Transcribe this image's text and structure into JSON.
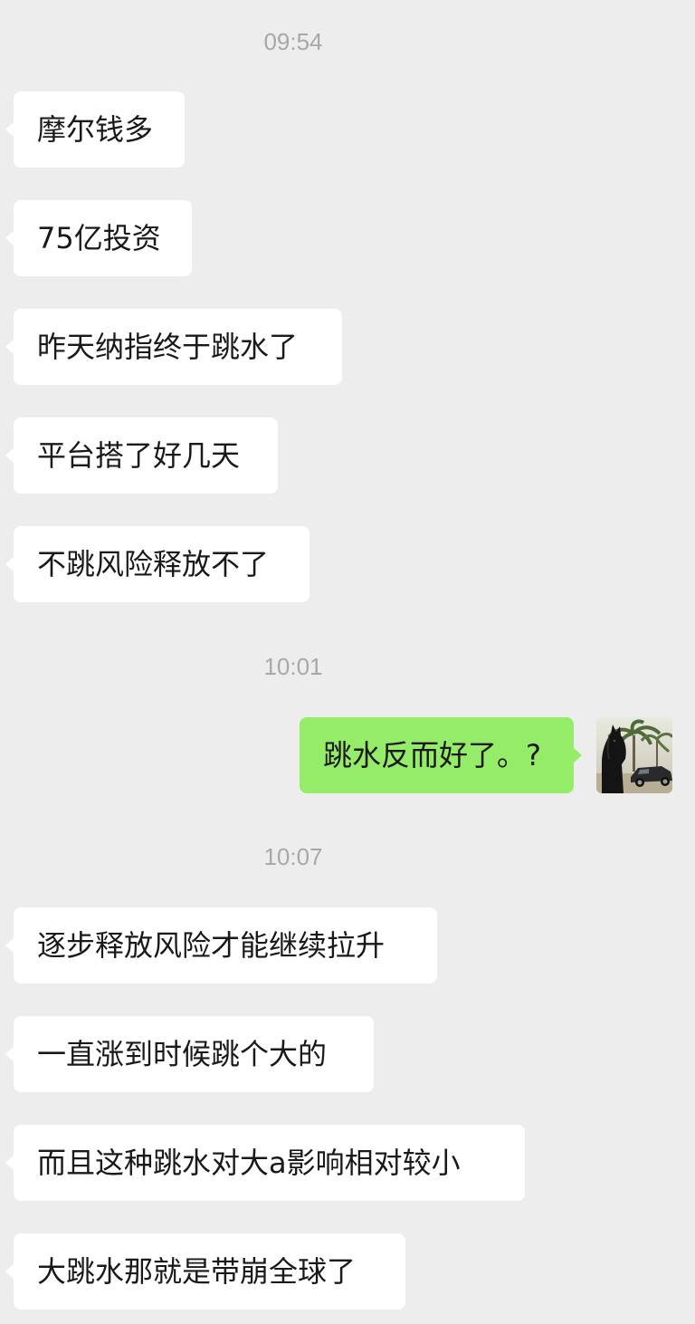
{
  "timestamps": [
    "09:54",
    "10:01",
    "10:07"
  ],
  "messages": [
    {
      "direction": "in",
      "text": "摩尔钱多"
    },
    {
      "direction": "in",
      "text": "75亿投资"
    },
    {
      "direction": "in",
      "text": "昨天纳指终于跳水了"
    },
    {
      "direction": "in",
      "text": "平台搭了好几天"
    },
    {
      "direction": "in",
      "text": "不跳风险释放不了"
    },
    {
      "direction": "out",
      "text": "跳水反而好了。?"
    },
    {
      "direction": "in",
      "text": "逐步释放风险才能继续拉升"
    },
    {
      "direction": "in",
      "text": "一直涨到时候跳个大的"
    },
    {
      "direction": "in",
      "text": "而且这种跳水对大a影响相对较小"
    },
    {
      "direction": "in",
      "text": "大跳水那就是带崩全球了"
    }
  ],
  "colors": {
    "background": "#ededed",
    "incoming_bubble": "#ffffff",
    "outgoing_bubble": "#95ec69",
    "timestamp": "#a8a8a8"
  },
  "icons": {
    "avatar": "horse-and-car-avatar"
  }
}
